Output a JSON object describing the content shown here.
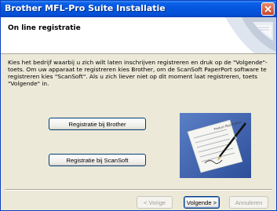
{
  "window": {
    "title": "Brother MFL-Pro Suite Installatie"
  },
  "header": {
    "title": "On line registratie"
  },
  "instructions": "Kies het bedrijf waarbij u zich wilt laten inschrijven registreren en druk op de \"Volgende\"-toets. Om uw apparaat te registreren kies Brother, om de ScanSoft PaperPort software te registreren kies \"ScanSoft\". Als u zich liever niet op dit moment laat registreren, toets \"Volgende\" in.",
  "buttons": {
    "register_brother": "Registratie bij Brother",
    "register_scansoft": "Registratie bij ScanSoft"
  },
  "nav": {
    "back": "< Vorige",
    "next": "Volgende >",
    "cancel": "Annuleren"
  },
  "icons": {
    "close": "close-icon",
    "header_graphic": "wizard-header-graphic",
    "illustration": "registration-form-pen-illustration"
  },
  "colors": {
    "titlebar": "#0655de",
    "dialog_bg": "#ece9d8",
    "illustration_bg": "#4a6db5"
  }
}
